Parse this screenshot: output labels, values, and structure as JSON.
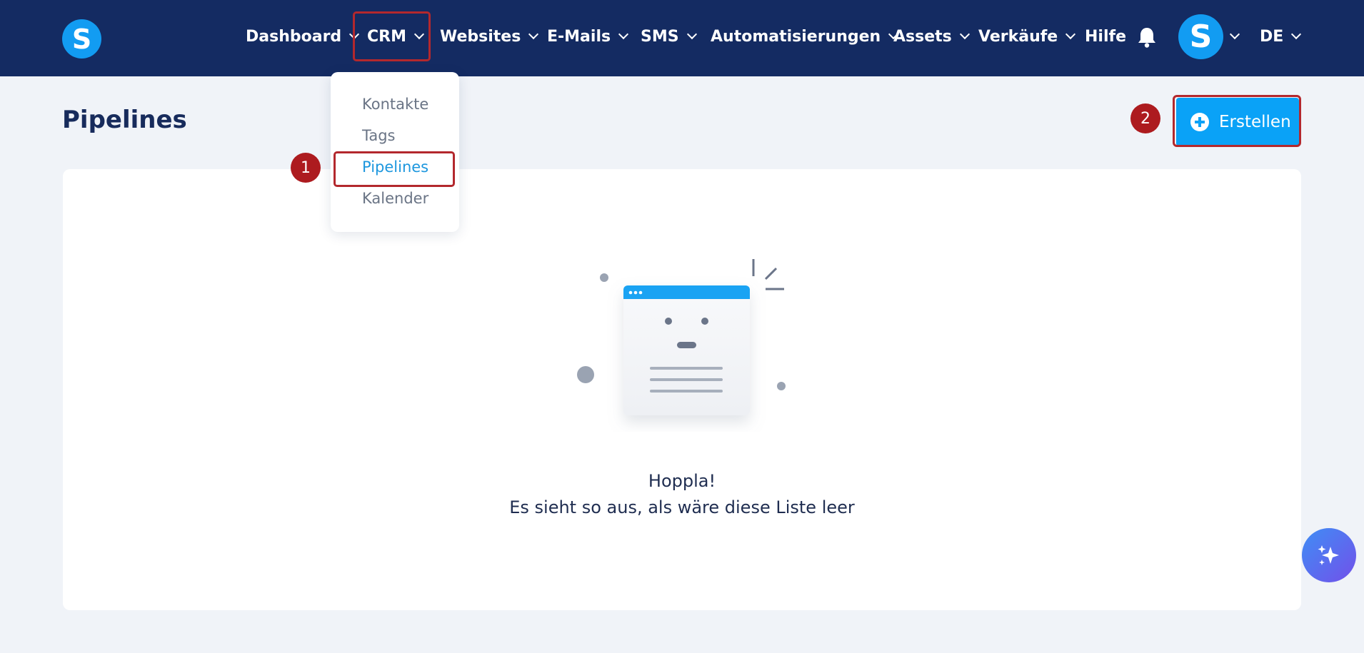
{
  "header": {
    "logo_letter": "S",
    "nav": [
      {
        "label": "Dashboard"
      },
      {
        "label": "CRM"
      },
      {
        "label": "Websites"
      },
      {
        "label": "E-Mails"
      },
      {
        "label": "SMS"
      },
      {
        "label": "Automatisierungen"
      },
      {
        "label": "Assets"
      },
      {
        "label": "Verkäufe"
      },
      {
        "label": "Hilfe"
      }
    ],
    "avatar_letter": "S",
    "language": "DE",
    "icons": [
      "bell-icon",
      "chevron-down-icon"
    ]
  },
  "crm_dropdown": {
    "items": [
      {
        "label": "Kontakte",
        "active": false
      },
      {
        "label": "Tags",
        "active": false
      },
      {
        "label": "Pipelines",
        "active": true
      },
      {
        "label": "Kalender",
        "active": false
      }
    ]
  },
  "annotations": {
    "step1": "1",
    "step2": "2",
    "highlight_color": "#b3282d"
  },
  "page": {
    "title": "Pipelines",
    "create_button_label": "Erstellen"
  },
  "empty_state": {
    "title": "Hoppla!",
    "message": "Es sieht so aus, als wäre diese Liste leer"
  },
  "colors": {
    "nav_bg": "#142b62",
    "accent": "#0aa2f7",
    "page_bg": "#f0f3f8"
  }
}
